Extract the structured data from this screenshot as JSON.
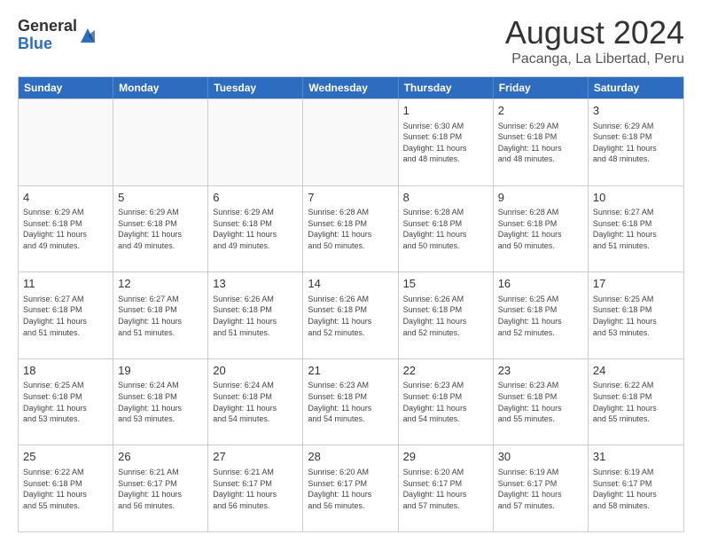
{
  "header": {
    "logo_general": "General",
    "logo_blue": "Blue",
    "main_title": "August 2024",
    "subtitle": "Pacanga, La Libertad, Peru"
  },
  "calendar": {
    "days_of_week": [
      "Sunday",
      "Monday",
      "Tuesday",
      "Wednesday",
      "Thursday",
      "Friday",
      "Saturday"
    ],
    "weeks": [
      [
        {
          "day": "",
          "info": ""
        },
        {
          "day": "",
          "info": ""
        },
        {
          "day": "",
          "info": ""
        },
        {
          "day": "",
          "info": ""
        },
        {
          "day": "1",
          "info": "Sunrise: 6:30 AM\nSunset: 6:18 PM\nDaylight: 11 hours\nand 48 minutes."
        },
        {
          "day": "2",
          "info": "Sunrise: 6:29 AM\nSunset: 6:18 PM\nDaylight: 11 hours\nand 48 minutes."
        },
        {
          "day": "3",
          "info": "Sunrise: 6:29 AM\nSunset: 6:18 PM\nDaylight: 11 hours\nand 48 minutes."
        }
      ],
      [
        {
          "day": "4",
          "info": "Sunrise: 6:29 AM\nSunset: 6:18 PM\nDaylight: 11 hours\nand 49 minutes."
        },
        {
          "day": "5",
          "info": "Sunrise: 6:29 AM\nSunset: 6:18 PM\nDaylight: 11 hours\nand 49 minutes."
        },
        {
          "day": "6",
          "info": "Sunrise: 6:29 AM\nSunset: 6:18 PM\nDaylight: 11 hours\nand 49 minutes."
        },
        {
          "day": "7",
          "info": "Sunrise: 6:28 AM\nSunset: 6:18 PM\nDaylight: 11 hours\nand 50 minutes."
        },
        {
          "day": "8",
          "info": "Sunrise: 6:28 AM\nSunset: 6:18 PM\nDaylight: 11 hours\nand 50 minutes."
        },
        {
          "day": "9",
          "info": "Sunrise: 6:28 AM\nSunset: 6:18 PM\nDaylight: 11 hours\nand 50 minutes."
        },
        {
          "day": "10",
          "info": "Sunrise: 6:27 AM\nSunset: 6:18 PM\nDaylight: 11 hours\nand 51 minutes."
        }
      ],
      [
        {
          "day": "11",
          "info": "Sunrise: 6:27 AM\nSunset: 6:18 PM\nDaylight: 11 hours\nand 51 minutes."
        },
        {
          "day": "12",
          "info": "Sunrise: 6:27 AM\nSunset: 6:18 PM\nDaylight: 11 hours\nand 51 minutes."
        },
        {
          "day": "13",
          "info": "Sunrise: 6:26 AM\nSunset: 6:18 PM\nDaylight: 11 hours\nand 51 minutes."
        },
        {
          "day": "14",
          "info": "Sunrise: 6:26 AM\nSunset: 6:18 PM\nDaylight: 11 hours\nand 52 minutes."
        },
        {
          "day": "15",
          "info": "Sunrise: 6:26 AM\nSunset: 6:18 PM\nDaylight: 11 hours\nand 52 minutes."
        },
        {
          "day": "16",
          "info": "Sunrise: 6:25 AM\nSunset: 6:18 PM\nDaylight: 11 hours\nand 52 minutes."
        },
        {
          "day": "17",
          "info": "Sunrise: 6:25 AM\nSunset: 6:18 PM\nDaylight: 11 hours\nand 53 minutes."
        }
      ],
      [
        {
          "day": "18",
          "info": "Sunrise: 6:25 AM\nSunset: 6:18 PM\nDaylight: 11 hours\nand 53 minutes."
        },
        {
          "day": "19",
          "info": "Sunrise: 6:24 AM\nSunset: 6:18 PM\nDaylight: 11 hours\nand 53 minutes."
        },
        {
          "day": "20",
          "info": "Sunrise: 6:24 AM\nSunset: 6:18 PM\nDaylight: 11 hours\nand 54 minutes."
        },
        {
          "day": "21",
          "info": "Sunrise: 6:23 AM\nSunset: 6:18 PM\nDaylight: 11 hours\nand 54 minutes."
        },
        {
          "day": "22",
          "info": "Sunrise: 6:23 AM\nSunset: 6:18 PM\nDaylight: 11 hours\nand 54 minutes."
        },
        {
          "day": "23",
          "info": "Sunrise: 6:23 AM\nSunset: 6:18 PM\nDaylight: 11 hours\nand 55 minutes."
        },
        {
          "day": "24",
          "info": "Sunrise: 6:22 AM\nSunset: 6:18 PM\nDaylight: 11 hours\nand 55 minutes."
        }
      ],
      [
        {
          "day": "25",
          "info": "Sunrise: 6:22 AM\nSunset: 6:18 PM\nDaylight: 11 hours\nand 55 minutes."
        },
        {
          "day": "26",
          "info": "Sunrise: 6:21 AM\nSunset: 6:17 PM\nDaylight: 11 hours\nand 56 minutes."
        },
        {
          "day": "27",
          "info": "Sunrise: 6:21 AM\nSunset: 6:17 PM\nDaylight: 11 hours\nand 56 minutes."
        },
        {
          "day": "28",
          "info": "Sunrise: 6:20 AM\nSunset: 6:17 PM\nDaylight: 11 hours\nand 56 minutes."
        },
        {
          "day": "29",
          "info": "Sunrise: 6:20 AM\nSunset: 6:17 PM\nDaylight: 11 hours\nand 57 minutes."
        },
        {
          "day": "30",
          "info": "Sunrise: 6:19 AM\nSunset: 6:17 PM\nDaylight: 11 hours\nand 57 minutes."
        },
        {
          "day": "31",
          "info": "Sunrise: 6:19 AM\nSunset: 6:17 PM\nDaylight: 11 hours\nand 58 minutes."
        }
      ]
    ]
  }
}
